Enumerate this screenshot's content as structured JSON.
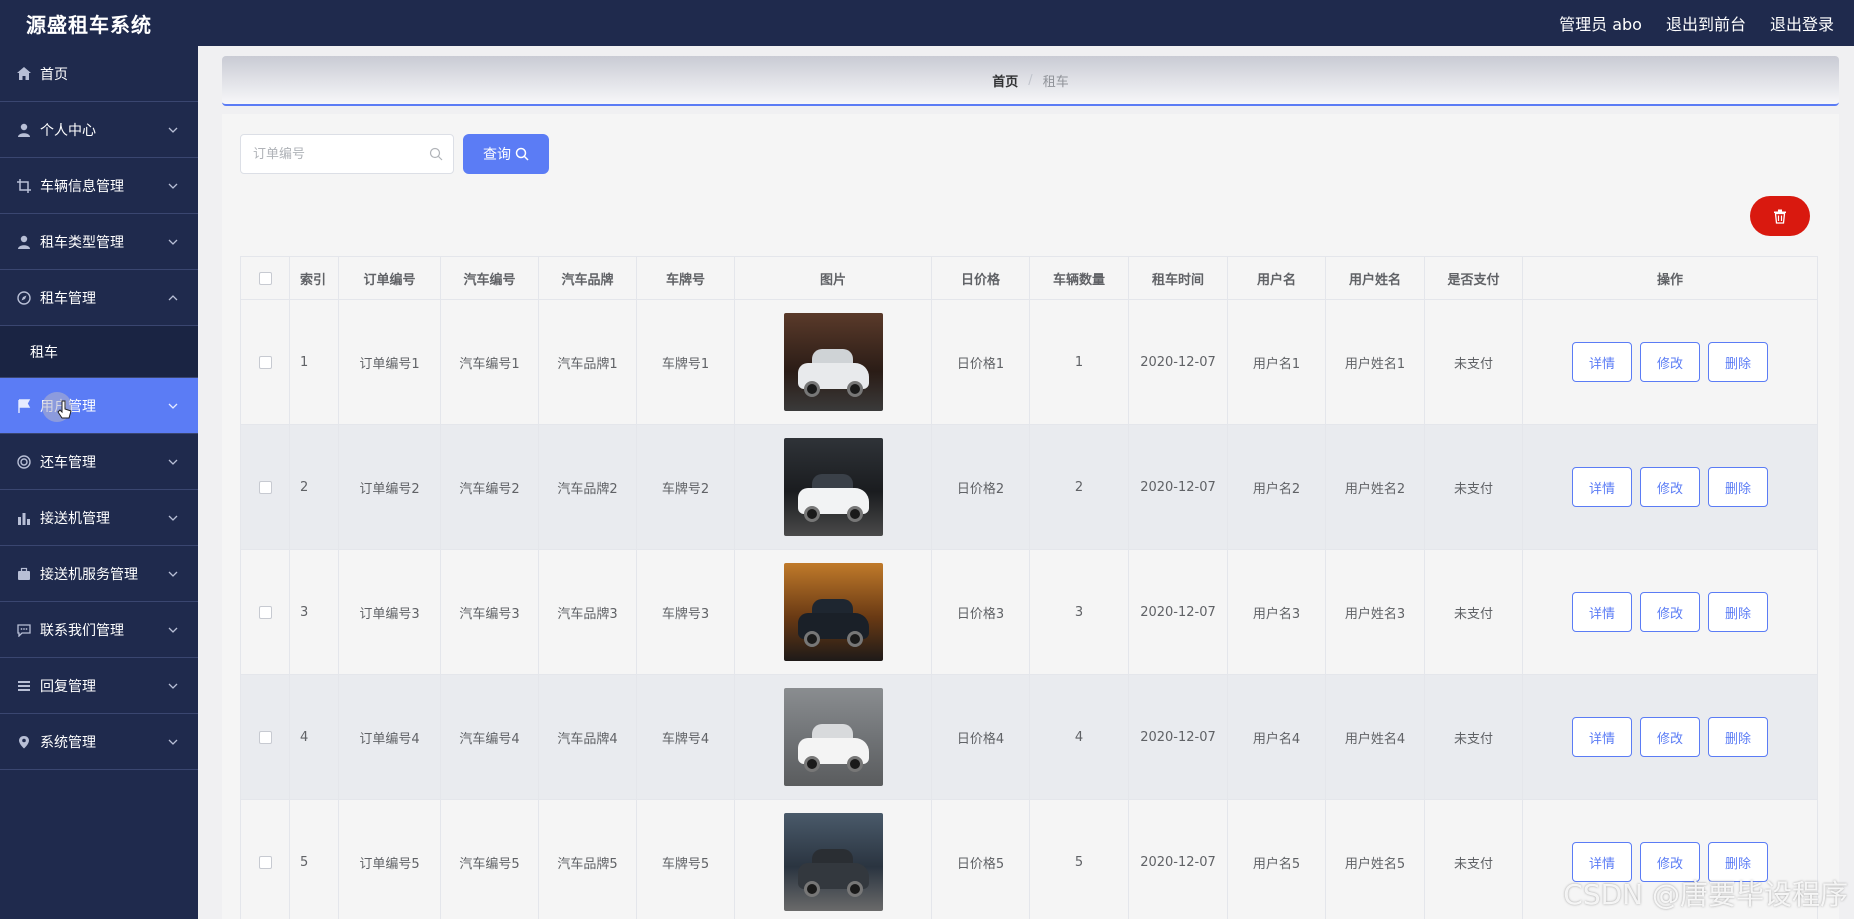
{
  "app": {
    "title": "源盛租车系统",
    "admin_label": "管理员 abo",
    "to_front_label": "退出到前台",
    "logout_label": "退出登录"
  },
  "sidebar": {
    "items": [
      {
        "label": "首页",
        "icon": "home-icon"
      },
      {
        "label": "个人中心",
        "icon": "user-icon"
      },
      {
        "label": "车辆信息管理",
        "icon": "crop-icon"
      },
      {
        "label": "租车类型管理",
        "icon": "user-icon"
      },
      {
        "label": "租车管理",
        "icon": "compass-icon",
        "expanded": true,
        "children": [
          {
            "label": "租车"
          }
        ]
      },
      {
        "label": "用户管理",
        "icon": "flag-icon",
        "active": true
      },
      {
        "label": "还车管理",
        "icon": "target-icon"
      },
      {
        "label": "接送机管理",
        "icon": "bar-chart-icon"
      },
      {
        "label": "接送机服务管理",
        "icon": "briefcase-icon"
      },
      {
        "label": "联系我们管理",
        "icon": "message-icon"
      },
      {
        "label": "回复管理",
        "icon": "list-icon"
      },
      {
        "label": "系统管理",
        "icon": "pin-icon"
      }
    ]
  },
  "breadcrumb": {
    "home": "首页",
    "separator": "/",
    "current": "租车"
  },
  "search": {
    "placeholder": "订单编号",
    "value": "",
    "query_label": "查询"
  },
  "table": {
    "headers": [
      "索引",
      "订单编号",
      "汽车编号",
      "汽车品牌",
      "车牌号",
      "图片",
      "日价格",
      "车辆数量",
      "租车时间",
      "用户名",
      "用户姓名",
      "是否支付",
      "操作"
    ],
    "actions": {
      "detail": "详情",
      "edit": "修改",
      "delete": "删除"
    },
    "rows": [
      {
        "idx": "1",
        "order": "订单编号1",
        "car": "汽车编号1",
        "brand": "汽车品牌1",
        "plate": "车牌号1",
        "price": "日价格1",
        "qty": "1",
        "time": "2020-12-07",
        "user": "用户名1",
        "uname": "用户姓名1",
        "paid": "未支付"
      },
      {
        "idx": "2",
        "order": "订单编号2",
        "car": "汽车编号2",
        "brand": "汽车品牌2",
        "plate": "车牌号2",
        "price": "日价格2",
        "qty": "2",
        "time": "2020-12-07",
        "user": "用户名2",
        "uname": "用户姓名2",
        "paid": "未支付"
      },
      {
        "idx": "3",
        "order": "订单编号3",
        "car": "汽车编号3",
        "brand": "汽车品牌3",
        "plate": "车牌号3",
        "price": "日价格3",
        "qty": "3",
        "time": "2020-12-07",
        "user": "用户名3",
        "uname": "用户姓名3",
        "paid": "未支付"
      },
      {
        "idx": "4",
        "order": "订单编号4",
        "car": "汽车编号4",
        "brand": "汽车品牌4",
        "plate": "车牌号4",
        "price": "日价格4",
        "qty": "4",
        "time": "2020-12-07",
        "user": "用户名4",
        "uname": "用户姓名4",
        "paid": "未支付"
      },
      {
        "idx": "5",
        "order": "订单编号5",
        "car": "汽车编号5",
        "brand": "汽车品牌5",
        "plate": "车牌号5",
        "price": "日价格5",
        "qty": "5",
        "time": "2020-12-07",
        "user": "用户名5",
        "uname": "用户姓名5",
        "paid": "未支付"
      }
    ]
  },
  "colors": {
    "nav_bg": "#1f2a4d",
    "accent": "#5b7cf5",
    "danger": "#d9190f"
  },
  "watermark": "CSDN @唐要毕设程序"
}
